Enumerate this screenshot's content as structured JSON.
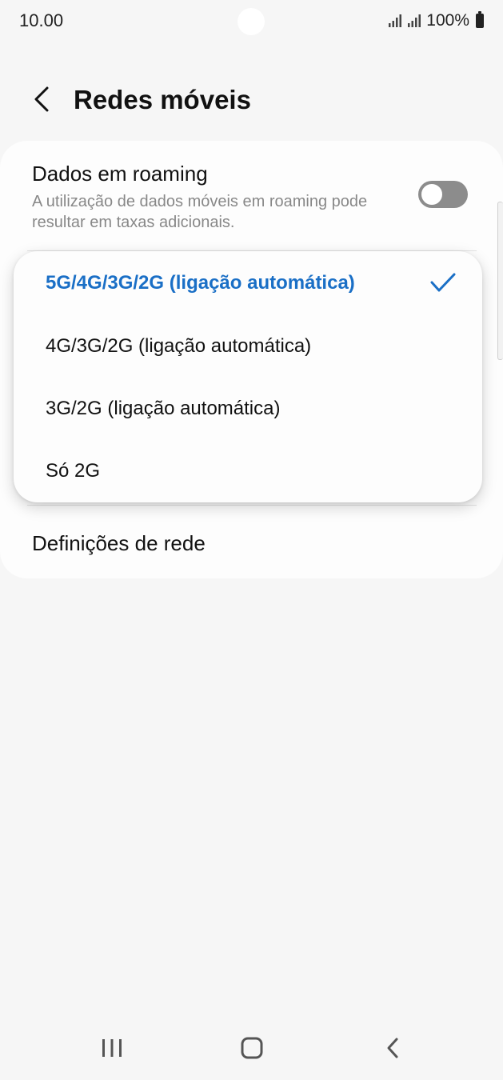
{
  "status_bar": {
    "time": "10.00",
    "battery": "100%",
    "icons": [
      "signal-icon",
      "signal-icon",
      "battery-icon"
    ]
  },
  "header": {
    "title": "Redes móveis",
    "back_icon": "chevron-left-icon"
  },
  "settings": {
    "roaming": {
      "title": "Dados em roaming",
      "subtitle": "A utilização de dados móveis em roaming pode resultar em taxas adicionais.",
      "enabled": false
    },
    "network_settings_label": "Definições de rede"
  },
  "network_mode_popup": {
    "options": [
      "5G/4G/3G/2G (ligação automática)",
      "4G/3G/2G (ligação automática)",
      "3G/2G (ligação automática)",
      "Só 2G"
    ],
    "selected_index": 0,
    "selected_icon": "checkmark-icon"
  },
  "colors": {
    "accent": "#1a6fc6",
    "background": "#f6f6f6",
    "card": "#fdfdfd",
    "secondary_text": "#888888"
  },
  "nav_bar": {
    "icons": [
      "recent-apps-icon",
      "home-icon",
      "back-icon"
    ]
  }
}
